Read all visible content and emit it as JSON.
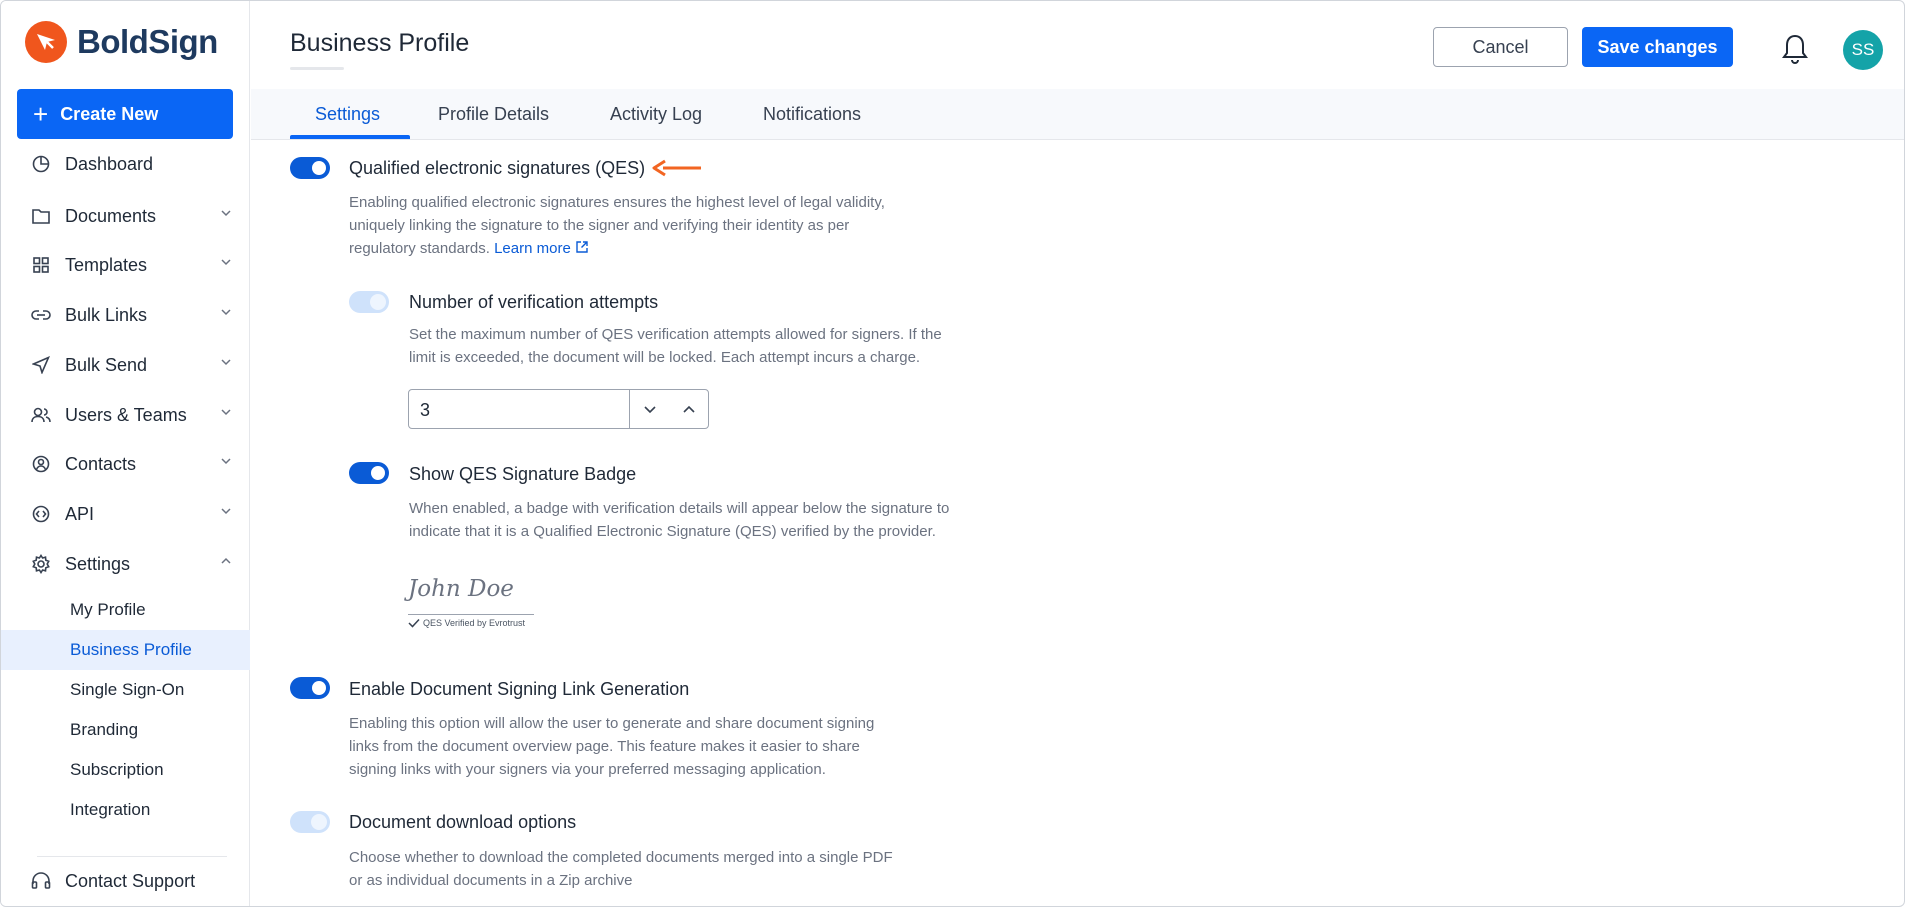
{
  "app": {
    "name": "BoldSign"
  },
  "sidebar": {
    "create_label": "Create New",
    "items": [
      {
        "label": "Dashboard",
        "icon": "dashboard-icon"
      },
      {
        "label": "Documents",
        "icon": "folder-icon"
      },
      {
        "label": "Templates",
        "icon": "grid-icon"
      },
      {
        "label": "Bulk Links",
        "icon": "link-icon"
      },
      {
        "label": "Bulk Send",
        "icon": "send-icon"
      },
      {
        "label": "Users & Teams",
        "icon": "users-icon"
      },
      {
        "label": "Contacts",
        "icon": "contact-icon"
      },
      {
        "label": "API",
        "icon": "api-icon"
      },
      {
        "label": "Settings",
        "icon": "gear-icon"
      }
    ],
    "settings_sub": [
      "My Profile",
      "Business Profile",
      "Single Sign-On",
      "Branding",
      "Subscription",
      "Integration"
    ],
    "active_sub": "Business Profile",
    "support_label": "Contact Support"
  },
  "header": {
    "title": "Business Profile",
    "cancel_label": "Cancel",
    "save_label": "Save changes",
    "avatar_initials": "SS"
  },
  "tabs": {
    "items": [
      "Settings",
      "Profile Details",
      "Activity Log",
      "Notifications"
    ],
    "active": "Settings"
  },
  "settings": {
    "qes": {
      "title": "Qualified electronic signatures (QES)",
      "enabled": true,
      "desc_lines": [
        "Enabling qualified electronic signatures ensures the highest level of legal validity,",
        "uniquely linking the signature to the signer and verifying their identity as per",
        "regulatory standards."
      ],
      "learn_more": "Learn more"
    },
    "attempts": {
      "title": "Number of verification attempts",
      "enabled": false,
      "desc_lines": [
        "Set the maximum number of QES verification attempts allowed for signers. If the",
        "limit is exceeded, the document will be locked. Each attempt incurs a charge."
      ],
      "value": "3"
    },
    "badge": {
      "title": "Show QES Signature Badge",
      "enabled": true,
      "desc_lines": [
        "When enabled, a badge with verification details will appear below the signature to",
        "indicate that it is a Qualified Electronic Signature (QES) verified by the provider."
      ],
      "signature_text": "John Doe",
      "verified_text": "QES Verified by Evrotrust"
    },
    "link_gen": {
      "title": "Enable Document Signing Link Generation",
      "enabled": true,
      "desc_lines": [
        "Enabling this option will allow the user to generate and share document signing",
        "links from the document overview page. This feature makes it easier to share",
        "signing links with your signers via your preferred messaging application."
      ]
    },
    "download": {
      "title": "Document download options",
      "enabled": false,
      "desc_lines": [
        "Choose whether to download the completed documents merged into a single PDF",
        "or as individual documents in a Zip archive"
      ]
    }
  },
  "colors": {
    "primary": "#0a66f5",
    "brand_orange": "#f0561d",
    "annotation_arrow": "#f26522",
    "avatar": "#14a3a8"
  }
}
